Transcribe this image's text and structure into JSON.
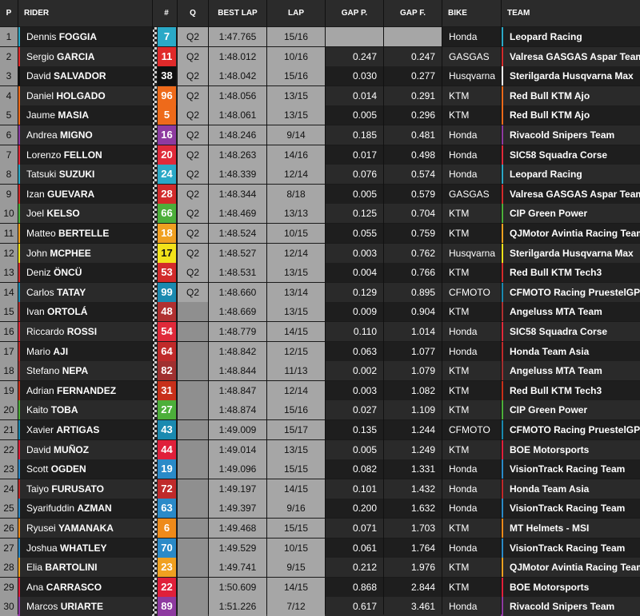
{
  "header": {
    "p": "P",
    "rider": "RIDER",
    "num": "#",
    "q": "Q",
    "best_lap": "BEST LAP",
    "lap": "LAP",
    "gap_p": "GAP P.",
    "gap_f": "GAP F.",
    "bike": "BIKE",
    "team": "TEAM"
  },
  "colors": {
    "row_dark": "#1e1e1e",
    "row_light": "#2a2a2a",
    "cell_grey": "#a6a6a6",
    "header": "#2b2b2b"
  },
  "rows": [
    {
      "p": "1",
      "first": "Dennis",
      "last": "FOGGIA",
      "num": "7",
      "numcolor": "#2aa9c7",
      "q": "Q2",
      "best": "1:47.765",
      "lap": "15/16",
      "gapp": "",
      "gapf": "",
      "bike": "Honda",
      "team": "Leopard Racing",
      "teamcolor": "#2aa9c7"
    },
    {
      "p": "2",
      "first": "Sergio",
      "last": "GARCIA",
      "num": "11",
      "numcolor": "#e02a2a",
      "q": "Q2",
      "best": "1:48.012",
      "lap": "10/16",
      "gapp": "0.247",
      "gapf": "0.247",
      "bike": "GASGAS",
      "team": "Valresa GASGAS Aspar Team",
      "teamcolor": "#d22b2b"
    },
    {
      "p": "3",
      "first": "David",
      "last": "SALVADOR",
      "num": "38",
      "numcolor": "#111111",
      "q": "Q2",
      "best": "1:48.042",
      "lap": "15/16",
      "gapp": "0.030",
      "gapf": "0.277",
      "bike": "Husqvarna",
      "team": "Sterilgarda Husqvarna Max",
      "teamcolor": "#ffffff"
    },
    {
      "p": "4",
      "first": "Daniel",
      "last": "HOLGADO",
      "num": "96",
      "numcolor": "#ee6a1a",
      "q": "Q2",
      "best": "1:48.056",
      "lap": "13/15",
      "gapp": "0.014",
      "gapf": "0.291",
      "bike": "KTM",
      "team": "Red Bull KTM Ajo",
      "teamcolor": "#ee6a1a"
    },
    {
      "p": "5",
      "first": "Jaume",
      "last": "MASIA",
      "num": "5",
      "numcolor": "#ee6a1a",
      "q": "Q2",
      "best": "1:48.061",
      "lap": "13/15",
      "gapp": "0.005",
      "gapf": "0.296",
      "bike": "KTM",
      "team": "Red Bull KTM Ajo",
      "teamcolor": "#ee6a1a"
    },
    {
      "p": "6",
      "first": "Andrea",
      "last": "MIGNO",
      "num": "16",
      "numcolor": "#8e3aa0",
      "q": "Q2",
      "best": "1:48.246",
      "lap": "9/14",
      "gapp": "0.185",
      "gapf": "0.481",
      "bike": "Honda",
      "team": "Rivacold Snipers Team",
      "teamcolor": "#8e3aa0"
    },
    {
      "p": "7",
      "first": "Lorenzo",
      "last": "FELLON",
      "num": "20",
      "numcolor": "#e02a3a",
      "q": "Q2",
      "best": "1:48.263",
      "lap": "14/16",
      "gapp": "0.017",
      "gapf": "0.498",
      "bike": "Honda",
      "team": "SIC58 Squadra Corse",
      "teamcolor": "#e02a3a"
    },
    {
      "p": "8",
      "first": "Tatsuki",
      "last": "SUZUKI",
      "num": "24",
      "numcolor": "#2aa9c7",
      "q": "Q2",
      "best": "1:48.339",
      "lap": "12/14",
      "gapp": "0.076",
      "gapf": "0.574",
      "bike": "Honda",
      "team": "Leopard Racing",
      "teamcolor": "#2aa9c7"
    },
    {
      "p": "9",
      "first": "Izan",
      "last": "GUEVARA",
      "num": "28",
      "numcolor": "#d22b2b",
      "q": "Q2",
      "best": "1:48.344",
      "lap": "8/18",
      "gapp": "0.005",
      "gapf": "0.579",
      "bike": "GASGAS",
      "team": "Valresa GASGAS Aspar Team",
      "teamcolor": "#d22b2b"
    },
    {
      "p": "10",
      "first": "Joel",
      "last": "KELSO",
      "num": "66",
      "numcolor": "#4caf3a",
      "q": "Q2",
      "best": "1:48.469",
      "lap": "13/13",
      "gapp": "0.125",
      "gapf": "0.704",
      "bike": "KTM",
      "team": "CIP Green Power",
      "teamcolor": "#4caf3a"
    },
    {
      "p": "11",
      "first": "Matteo",
      "last": "BERTELLE",
      "num": "18",
      "numcolor": "#f0a020",
      "q": "Q2",
      "best": "1:48.524",
      "lap": "10/15",
      "gapp": "0.055",
      "gapf": "0.759",
      "bike": "KTM",
      "team": "QJMotor Avintia Racing Team",
      "teamcolor": "#f0a020"
    },
    {
      "p": "12",
      "first": "John",
      "last": "MCPHEE",
      "num": "17",
      "numcolor": "#f2e21a",
      "q": "Q2",
      "best": "1:48.527",
      "lap": "12/14",
      "gapp": "0.003",
      "gapf": "0.762",
      "bike": "Husqvarna",
      "team": "Sterilgarda Husqvarna Max",
      "teamcolor": "#f2e21a"
    },
    {
      "p": "13",
      "first": "Deniz",
      "last": "ÖNCÜ",
      "num": "53",
      "numcolor": "#d22b2b",
      "q": "Q2",
      "best": "1:48.531",
      "lap": "13/15",
      "gapp": "0.004",
      "gapf": "0.766",
      "bike": "KTM",
      "team": "Red Bull KTM Tech3",
      "teamcolor": "#d22b2b"
    },
    {
      "p": "14",
      "first": "Carlos",
      "last": "TATAY",
      "num": "99",
      "numcolor": "#1a8ab0",
      "q": "Q2",
      "best": "1:48.660",
      "lap": "13/14",
      "gapp": "0.129",
      "gapf": "0.895",
      "bike": "CFMOTO",
      "team": "CFMOTO Racing PruestelGP",
      "teamcolor": "#1a8ab0"
    },
    {
      "p": "15",
      "first": "Ivan",
      "last": "ORTOLÁ",
      "num": "48",
      "numcolor": "#b03030",
      "q": "",
      "best": "1:48.669",
      "lap": "13/15",
      "gapp": "0.009",
      "gapf": "0.904",
      "bike": "KTM",
      "team": "Angeluss MTA Team",
      "teamcolor": "#b03030"
    },
    {
      "p": "16",
      "first": "Riccardo",
      "last": "ROSSI",
      "num": "54",
      "numcolor": "#e02a3a",
      "q": "",
      "best": "1:48.779",
      "lap": "14/15",
      "gapp": "0.110",
      "gapf": "1.014",
      "bike": "Honda",
      "team": "SIC58 Squadra Corse",
      "teamcolor": "#e02a3a"
    },
    {
      "p": "17",
      "first": "Mario",
      "last": "AJI",
      "num": "64",
      "numcolor": "#c02a2a",
      "q": "",
      "best": "1:48.842",
      "lap": "12/15",
      "gapp": "0.063",
      "gapf": "1.077",
      "bike": "Honda",
      "team": "Honda Team Asia",
      "teamcolor": "#c02a2a"
    },
    {
      "p": "18",
      "first": "Stefano",
      "last": "NEPA",
      "num": "82",
      "numcolor": "#a03030",
      "q": "",
      "best": "1:48.844",
      "lap": "11/13",
      "gapp": "0.002",
      "gapf": "1.079",
      "bike": "KTM",
      "team": "Angeluss MTA Team",
      "teamcolor": "#a03030"
    },
    {
      "p": "19",
      "first": "Adrian",
      "last": "FERNANDEZ",
      "num": "31",
      "numcolor": "#c8301a",
      "q": "",
      "best": "1:48.847",
      "lap": "12/14",
      "gapp": "0.003",
      "gapf": "1.082",
      "bike": "KTM",
      "team": "Red Bull KTM Tech3",
      "teamcolor": "#c8301a"
    },
    {
      "p": "20",
      "first": "Kaito",
      "last": "TOBA",
      "num": "27",
      "numcolor": "#4caf3a",
      "q": "",
      "best": "1:48.874",
      "lap": "15/16",
      "gapp": "0.027",
      "gapf": "1.109",
      "bike": "KTM",
      "team": "CIP Green Power",
      "teamcolor": "#4caf3a"
    },
    {
      "p": "21",
      "first": "Xavier",
      "last": "ARTIGAS",
      "num": "43",
      "numcolor": "#1a8ab0",
      "q": "",
      "best": "1:49.009",
      "lap": "15/17",
      "gapp": "0.135",
      "gapf": "1.244",
      "bike": "CFMOTO",
      "team": "CFMOTO Racing PruestelGP",
      "teamcolor": "#1a8ab0"
    },
    {
      "p": "22",
      "first": "David",
      "last": "MUÑOZ",
      "num": "44",
      "numcolor": "#e0203a",
      "q": "",
      "best": "1:49.014",
      "lap": "13/15",
      "gapp": "0.005",
      "gapf": "1.249",
      "bike": "KTM",
      "team": "BOE Motorsports",
      "teamcolor": "#e0203a"
    },
    {
      "p": "23",
      "first": "Scott",
      "last": "OGDEN",
      "num": "19",
      "numcolor": "#2a8ac8",
      "q": "",
      "best": "1:49.096",
      "lap": "15/15",
      "gapp": "0.082",
      "gapf": "1.331",
      "bike": "Honda",
      "team": "VisionTrack Racing Team",
      "teamcolor": "#2a8ac8"
    },
    {
      "p": "24",
      "first": "Taiyo",
      "last": "FURUSATO",
      "num": "72",
      "numcolor": "#c02a2a",
      "q": "",
      "best": "1:49.197",
      "lap": "14/15",
      "gapp": "0.101",
      "gapf": "1.432",
      "bike": "Honda",
      "team": "Honda Team Asia",
      "teamcolor": "#c02a2a"
    },
    {
      "p": "25",
      "first": "Syarifuddin",
      "last": "AZMAN",
      "num": "63",
      "numcolor": "#2a8ac8",
      "q": "",
      "best": "1:49.397",
      "lap": "9/16",
      "gapp": "0.200",
      "gapf": "1.632",
      "bike": "Honda",
      "team": "VisionTrack Racing Team",
      "teamcolor": "#2a8ac8"
    },
    {
      "p": "26",
      "first": "Ryusei",
      "last": "YAMANAKA",
      "num": "6",
      "numcolor": "#ee8a1a",
      "q": "",
      "best": "1:49.468",
      "lap": "15/15",
      "gapp": "0.071",
      "gapf": "1.703",
      "bike": "KTM",
      "team": "MT Helmets - MSI",
      "teamcolor": "#ee8a1a"
    },
    {
      "p": "27",
      "first": "Joshua",
      "last": "WHATLEY",
      "num": "70",
      "numcolor": "#2a8ac8",
      "q": "",
      "best": "1:49.529",
      "lap": "10/15",
      "gapp": "0.061",
      "gapf": "1.764",
      "bike": "Honda",
      "team": "VisionTrack Racing Team",
      "teamcolor": "#2a8ac8"
    },
    {
      "p": "28",
      "first": "Elia",
      "last": "BARTOLINI",
      "num": "23",
      "numcolor": "#f0a020",
      "q": "",
      "best": "1:49.741",
      "lap": "9/15",
      "gapp": "0.212",
      "gapf": "1.976",
      "bike": "KTM",
      "team": "QJMotor Avintia Racing Team",
      "teamcolor": "#f0a020"
    },
    {
      "p": "29",
      "first": "Ana",
      "last": "CARRASCO",
      "num": "22",
      "numcolor": "#e0203a",
      "q": "",
      "best": "1:50.609",
      "lap": "14/15",
      "gapp": "0.868",
      "gapf": "2.844",
      "bike": "KTM",
      "team": "BOE Motorsports",
      "teamcolor": "#e0203a"
    },
    {
      "p": "30",
      "first": "Marcos",
      "last": "URIARTE",
      "num": "89",
      "numcolor": "#8e3aa0",
      "q": "",
      "best": "1:51.226",
      "lap": "7/12",
      "gapp": "0.617",
      "gapf": "3.461",
      "bike": "Honda",
      "team": "Rivacold Snipers Team",
      "teamcolor": "#8e3aa0"
    }
  ]
}
